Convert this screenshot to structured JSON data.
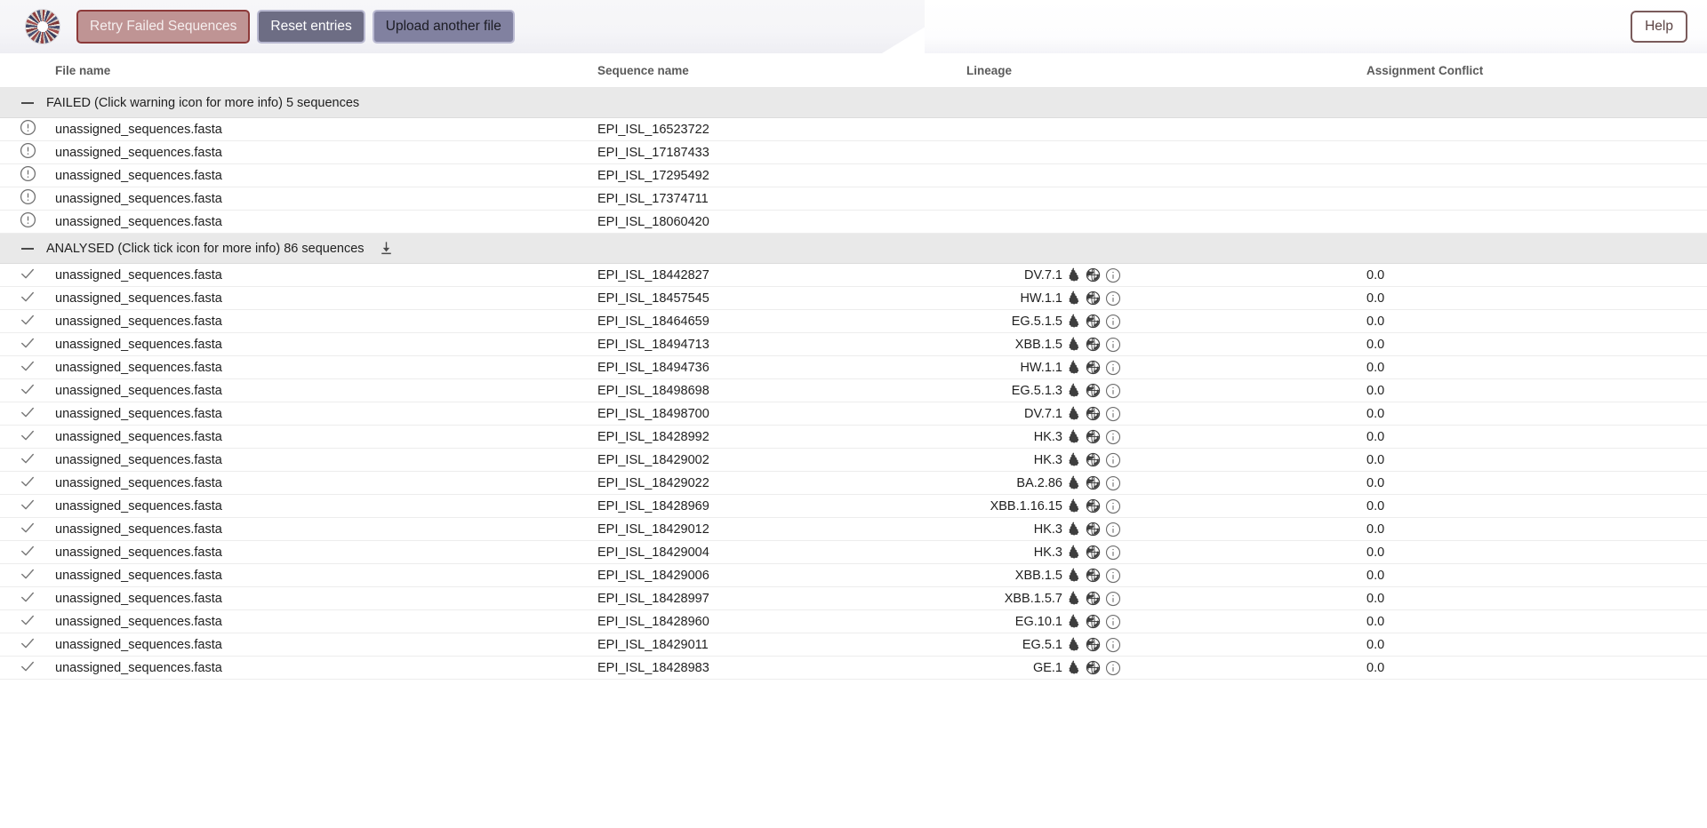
{
  "header": {
    "logo_name": "circular-segmented-logo",
    "buttons": {
      "retry": "Retry Failed Sequences",
      "reset": "Reset entries",
      "upload": "Upload another file",
      "help": "Help"
    },
    "colors": {
      "retry_bg": "#bf9494",
      "retry_border": "#8d3a3a",
      "reset_bg": "#6d6d84",
      "upload_bg": "#8181a0",
      "button_border": "#b9b9d1",
      "help_border": "#7a5b5b",
      "group_row_bg": "#e9e9e9"
    }
  },
  "table": {
    "columns": [
      "File name",
      "Sequence name",
      "Lineage",
      "Assignment Conflict"
    ],
    "groups": [
      {
        "id": "failed",
        "label": "FAILED (Click warning icon for more info) 5 sequences",
        "status_icon": "warning-circle-icon",
        "has_download": false,
        "rows": [
          {
            "file": "unassigned_sequences.fasta",
            "sequence": "EPI_ISL_16523722",
            "lineage": "",
            "conflict": ""
          },
          {
            "file": "unassigned_sequences.fasta",
            "sequence": "EPI_ISL_17187433",
            "lineage": "",
            "conflict": ""
          },
          {
            "file": "unassigned_sequences.fasta",
            "sequence": "EPI_ISL_17295492",
            "lineage": "",
            "conflict": ""
          },
          {
            "file": "unassigned_sequences.fasta",
            "sequence": "EPI_ISL_17374711",
            "lineage": "",
            "conflict": ""
          },
          {
            "file": "unassigned_sequences.fasta",
            "sequence": "EPI_ISL_18060420",
            "lineage": "",
            "conflict": ""
          }
        ]
      },
      {
        "id": "analysed",
        "label": "ANALYSED (Click tick icon for more info) 86 sequences",
        "status_icon": "check-icon",
        "has_download": true,
        "download_icon": "download-icon",
        "rows": [
          {
            "file": "unassigned_sequences.fasta",
            "sequence": "EPI_ISL_18442827",
            "lineage": "DV.7.1",
            "conflict": "0.0"
          },
          {
            "file": "unassigned_sequences.fasta",
            "sequence": "EPI_ISL_18457545",
            "lineage": "HW.1.1",
            "conflict": "0.0"
          },
          {
            "file": "unassigned_sequences.fasta",
            "sequence": "EPI_ISL_18464659",
            "lineage": "EG.5.1.5",
            "conflict": "0.0"
          },
          {
            "file": "unassigned_sequences.fasta",
            "sequence": "EPI_ISL_18494713",
            "lineage": "XBB.1.5",
            "conflict": "0.0"
          },
          {
            "file": "unassigned_sequences.fasta",
            "sequence": "EPI_ISL_18494736",
            "lineage": "HW.1.1",
            "conflict": "0.0"
          },
          {
            "file": "unassigned_sequences.fasta",
            "sequence": "EPI_ISL_18498698",
            "lineage": "EG.5.1.3",
            "conflict": "0.0"
          },
          {
            "file": "unassigned_sequences.fasta",
            "sequence": "EPI_ISL_18498700",
            "lineage": "DV.7.1",
            "conflict": "0.0"
          },
          {
            "file": "unassigned_sequences.fasta",
            "sequence": "EPI_ISL_18428992",
            "lineage": "HK.3",
            "conflict": "0.0"
          },
          {
            "file": "unassigned_sequences.fasta",
            "sequence": "EPI_ISL_18429002",
            "lineage": "HK.3",
            "conflict": "0.0"
          },
          {
            "file": "unassigned_sequences.fasta",
            "sequence": "EPI_ISL_18429022",
            "lineage": "BA.2.86",
            "conflict": "0.0"
          },
          {
            "file": "unassigned_sequences.fasta",
            "sequence": "EPI_ISL_18428969",
            "lineage": "XBB.1.16.15",
            "conflict": "0.0"
          },
          {
            "file": "unassigned_sequences.fasta",
            "sequence": "EPI_ISL_18429012",
            "lineage": "HK.3",
            "conflict": "0.0"
          },
          {
            "file": "unassigned_sequences.fasta",
            "sequence": "EPI_ISL_18429004",
            "lineage": "HK.3",
            "conflict": "0.0"
          },
          {
            "file": "unassigned_sequences.fasta",
            "sequence": "EPI_ISL_18429006",
            "lineage": "XBB.1.5",
            "conflict": "0.0"
          },
          {
            "file": "unassigned_sequences.fasta",
            "sequence": "EPI_ISL_18428997",
            "lineage": "XBB.1.5.7",
            "conflict": "0.0"
          },
          {
            "file": "unassigned_sequences.fasta",
            "sequence": "EPI_ISL_18428960",
            "lineage": "EG.10.1",
            "conflict": "0.0"
          },
          {
            "file": "unassigned_sequences.fasta",
            "sequence": "EPI_ISL_18429011",
            "lineage": "EG.5.1",
            "conflict": "0.0"
          },
          {
            "file": "unassigned_sequences.fasta",
            "sequence": "EPI_ISL_18428983",
            "lineage": "GE.1",
            "conflict": "0.0"
          }
        ]
      }
    ],
    "lineage_icons": [
      "uk-map-icon",
      "globe-icon",
      "info-circle-icon"
    ]
  }
}
